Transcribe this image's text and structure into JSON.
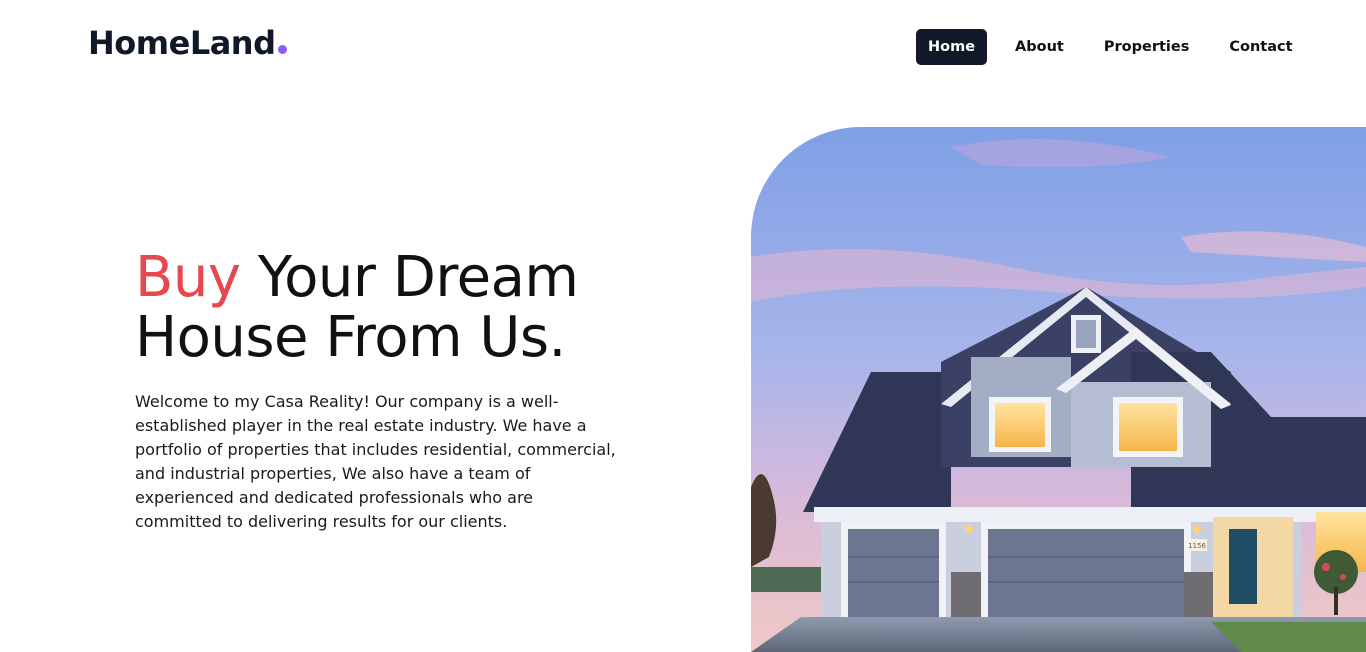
{
  "brand": {
    "name": "HomeLand",
    "dot_color": "#8b5cf6"
  },
  "nav": {
    "items": [
      {
        "label": "Home",
        "active": true
      },
      {
        "label": "About"
      },
      {
        "label": "Properties"
      },
      {
        "label": "Contact"
      }
    ]
  },
  "hero": {
    "title_accent": "Buy",
    "title_line1_rest": "Your Dream",
    "title_line2": "House From Us.",
    "description": "Welcome to my Casa Reality! Our company is a well-established player in the real estate industry. We have a portfolio of properties that includes residential, commercial, and industrial properties, We also have a team of experienced and dedicated professionals who are committed to delivering results for our clients.",
    "image_house_number": "1156"
  },
  "colors": {
    "accent": "#e5484d",
    "nav_active_bg": "#111827",
    "text": "#111111"
  }
}
